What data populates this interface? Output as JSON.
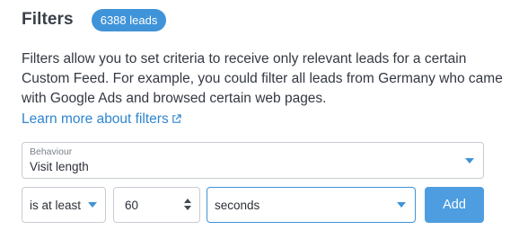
{
  "header": {
    "title": "Filters",
    "badge": "6388 leads"
  },
  "description": "Filters allow you to set criteria to receive only relevant leads for a certain Custom Feed. For example, you could filter all leads from Germany who came with Google Ads and browsed certain web pages.",
  "learn_more": {
    "label": "Learn more about filters",
    "icon": "external-link-icon"
  },
  "behaviour_select": {
    "label": "Behaviour",
    "value": "Visit length"
  },
  "condition": {
    "operator": "is at least",
    "number": "60",
    "unit": "seconds"
  },
  "add_button": {
    "label": "Add"
  },
  "colors": {
    "accent": "#3f93d8",
    "link": "#2f86cf",
    "button": "#4d9de0",
    "border": "#c7ccd3"
  }
}
